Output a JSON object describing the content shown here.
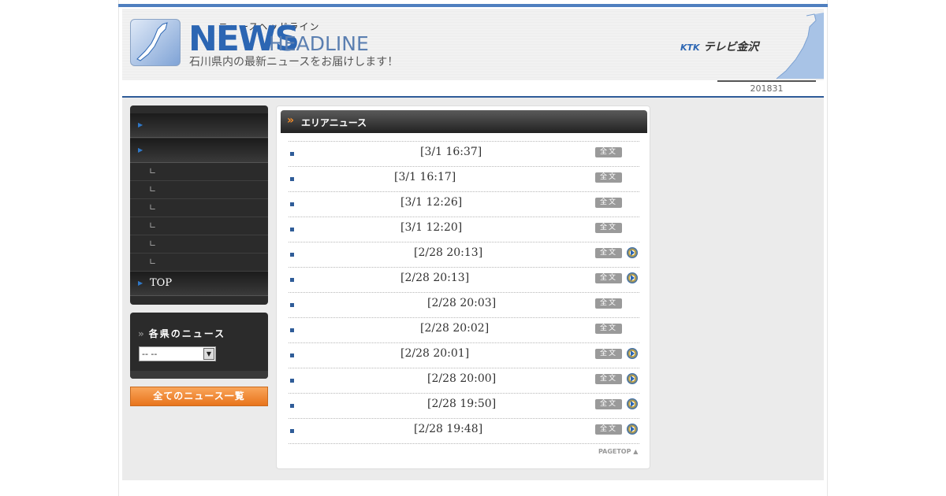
{
  "header": {
    "kana": "ニュースヘッドライン",
    "news": "NEWS",
    "headline": "HEADLINE",
    "tagline": "石川県内の最新ニュースをお届けします！",
    "station_mark": "KTK",
    "station": "テレビ金沢",
    "date": "201831"
  },
  "nav": {
    "items": [
      {
        "label": "",
        "type": "main"
      },
      {
        "label": "",
        "type": "main"
      },
      {
        "label": "",
        "type": "sub"
      },
      {
        "label": "",
        "type": "sub"
      },
      {
        "label": "",
        "type": "sub"
      },
      {
        "label": "",
        "type": "sub"
      },
      {
        "label": "",
        "type": "sub"
      },
      {
        "label": "",
        "type": "sub"
      },
      {
        "label": "TOP",
        "type": "main"
      }
    ]
  },
  "prefecture": {
    "title": "各県のニュース",
    "selected": "--  --"
  },
  "all_news_label": "全てのニュース一覧",
  "area_news": {
    "title": "エリアニュース",
    "full_label": "全文",
    "items": [
      {
        "date": "[3/1 16:37]",
        "video": false
      },
      {
        "date": "[3/1 16:17]",
        "video": false
      },
      {
        "date": "[3/1 12:26]",
        "video": false
      },
      {
        "date": "[3/1 12:20]",
        "video": false
      },
      {
        "date": "[2/28 20:13]",
        "video": true
      },
      {
        "date": "[2/28 20:13]",
        "video": true
      },
      {
        "date": "[2/28 20:03]",
        "video": false
      },
      {
        "date": "[2/28 20:02]",
        "video": false
      },
      {
        "date": "[2/28 20:01]",
        "video": true
      },
      {
        "date": "[2/28 20:00]",
        "video": true
      },
      {
        "date": "[2/28 19:50]",
        "video": true
      },
      {
        "date": "[2/28 19:48]",
        "video": true
      }
    ],
    "pagetop": "PAGETOP ▲"
  }
}
